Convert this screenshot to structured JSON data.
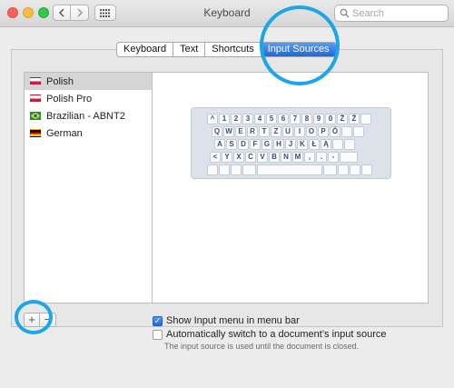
{
  "window": {
    "title": "Keyboard"
  },
  "search": {
    "placeholder": "Search"
  },
  "tabs": [
    {
      "label": "Keyboard"
    },
    {
      "label": "Text"
    },
    {
      "label": "Shortcuts"
    },
    {
      "label": "Input Sources",
      "active": true
    }
  ],
  "sources": [
    {
      "label": "Polish",
      "flag": "poland-flag",
      "selected": true
    },
    {
      "label": "Polish Pro",
      "flag": "poland-pro-flag"
    },
    {
      "label": "Brazilian - ABNT2",
      "flag": "brazil-flag"
    },
    {
      "label": "German",
      "flag": "germany-flag"
    }
  ],
  "keyboard": {
    "row1": [
      "^",
      "1",
      "2",
      "3",
      "4",
      "5",
      "6",
      "7",
      "8",
      "9",
      "0",
      "Ż",
      "Ź"
    ],
    "row2": [
      "Q",
      "W",
      "E",
      "R",
      "T",
      "Z",
      "U",
      "I",
      "O",
      "P",
      "Ó"
    ],
    "row3": [
      "A",
      "S",
      "D",
      "F",
      "G",
      "H",
      "J",
      "K",
      "Ł",
      "Ą"
    ],
    "row4": [
      "<",
      "Y",
      "X",
      "C",
      "V",
      "B",
      "N",
      "M",
      ",",
      ".",
      "-"
    ]
  },
  "buttons": {
    "add": "+",
    "remove": "−"
  },
  "options": {
    "show_menu": {
      "label": "Show Input menu in menu bar",
      "checked": true
    },
    "auto_switch": {
      "label": "Automatically switch to a document’s input source",
      "checked": false
    },
    "note": "The input source is used until the document is closed."
  },
  "colors": {
    "accent": "#2067d8",
    "highlight_ring": "#1aa6e8"
  }
}
